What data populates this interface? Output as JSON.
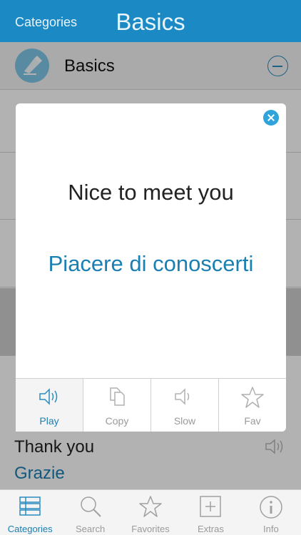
{
  "navbar": {
    "back_label": "Categories",
    "title": "Basics"
  },
  "section": {
    "title": "Basics",
    "icon": "pencil-note-icon"
  },
  "modal": {
    "english": "Nice to meet you",
    "italian": "Piacere di conoscerti",
    "actions": [
      {
        "label": "Play",
        "icon": "speaker-icon",
        "active": true
      },
      {
        "label": "Copy",
        "icon": "copy-icon",
        "active": false
      },
      {
        "label": "Slow",
        "icon": "speaker-icon",
        "active": false
      },
      {
        "label": "Fav",
        "icon": "star-icon",
        "active": false
      }
    ]
  },
  "list": {
    "visible_row": {
      "english": "Thank you",
      "italian": "Grazie"
    }
  },
  "tabbar": {
    "tabs": [
      {
        "label": "Categories",
        "icon": "list-icon",
        "active": true
      },
      {
        "label": "Search",
        "icon": "search-icon",
        "active": false
      },
      {
        "label": "Favorites",
        "icon": "star-icon",
        "active": false
      },
      {
        "label": "Extras",
        "icon": "plus-box-icon",
        "active": false
      },
      {
        "label": "Info",
        "icon": "info-icon",
        "active": false
      }
    ]
  },
  "colors": {
    "accent": "#1b8ac4",
    "italian_text": "#1a7fb3",
    "inactive": "#9a9a9a"
  }
}
